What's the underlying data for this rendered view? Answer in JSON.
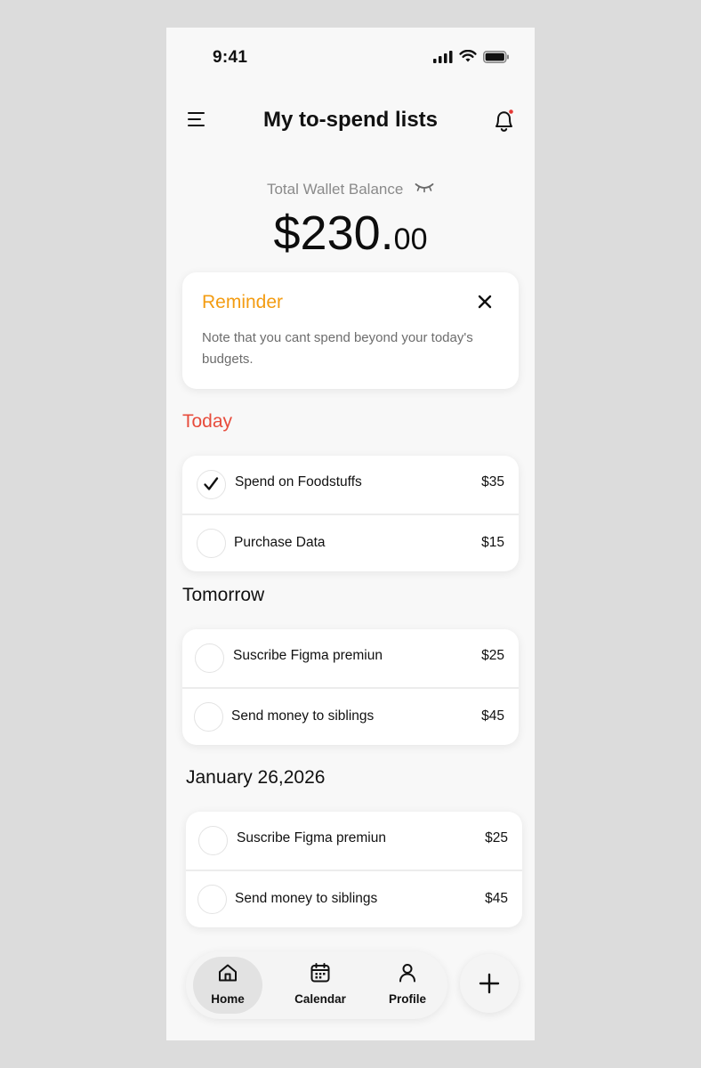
{
  "status_bar": {
    "time": "9:41"
  },
  "header": {
    "title": "My to-spend lists"
  },
  "wallet": {
    "label": "Total Wallet Balance",
    "amount_main": "$230.",
    "amount_cents": "00"
  },
  "reminder": {
    "title": "Reminder",
    "text": "Note that you cant spend beyond your today's budgets."
  },
  "sections": [
    {
      "title": "Today",
      "title_color": "#e74c3c",
      "items": [
        {
          "label": "Spend on Foodstuffs",
          "amount": "$35",
          "checked": true
        },
        {
          "label": "Purchase Data",
          "amount": "$15",
          "checked": false
        }
      ]
    },
    {
      "title": "Tomorrow",
      "title_color": "#111111",
      "items": [
        {
          "label": "Suscribe Figma premiun",
          "amount": "$25",
          "checked": false
        },
        {
          "label": "Send money to siblings",
          "amount": "$45",
          "checked": false
        }
      ]
    },
    {
      "title": "January 26,2026",
      "title_color": "#111111",
      "items": [
        {
          "label": "Suscribe Figma premiun",
          "amount": "$25",
          "checked": false
        },
        {
          "label": "Send money to siblings",
          "amount": "$45",
          "checked": false
        }
      ]
    }
  ],
  "nav": {
    "items": [
      {
        "label": "Home",
        "icon": "home-icon",
        "active": true
      },
      {
        "label": "Calendar",
        "icon": "calendar-icon",
        "active": false
      },
      {
        "label": "Profile",
        "icon": "profile-icon",
        "active": false
      }
    ],
    "fab_icon": "plus-icon"
  },
  "colors": {
    "accent_orange": "#f39c12",
    "today_red": "#e74c3c",
    "notification_dot": "#e53935"
  }
}
